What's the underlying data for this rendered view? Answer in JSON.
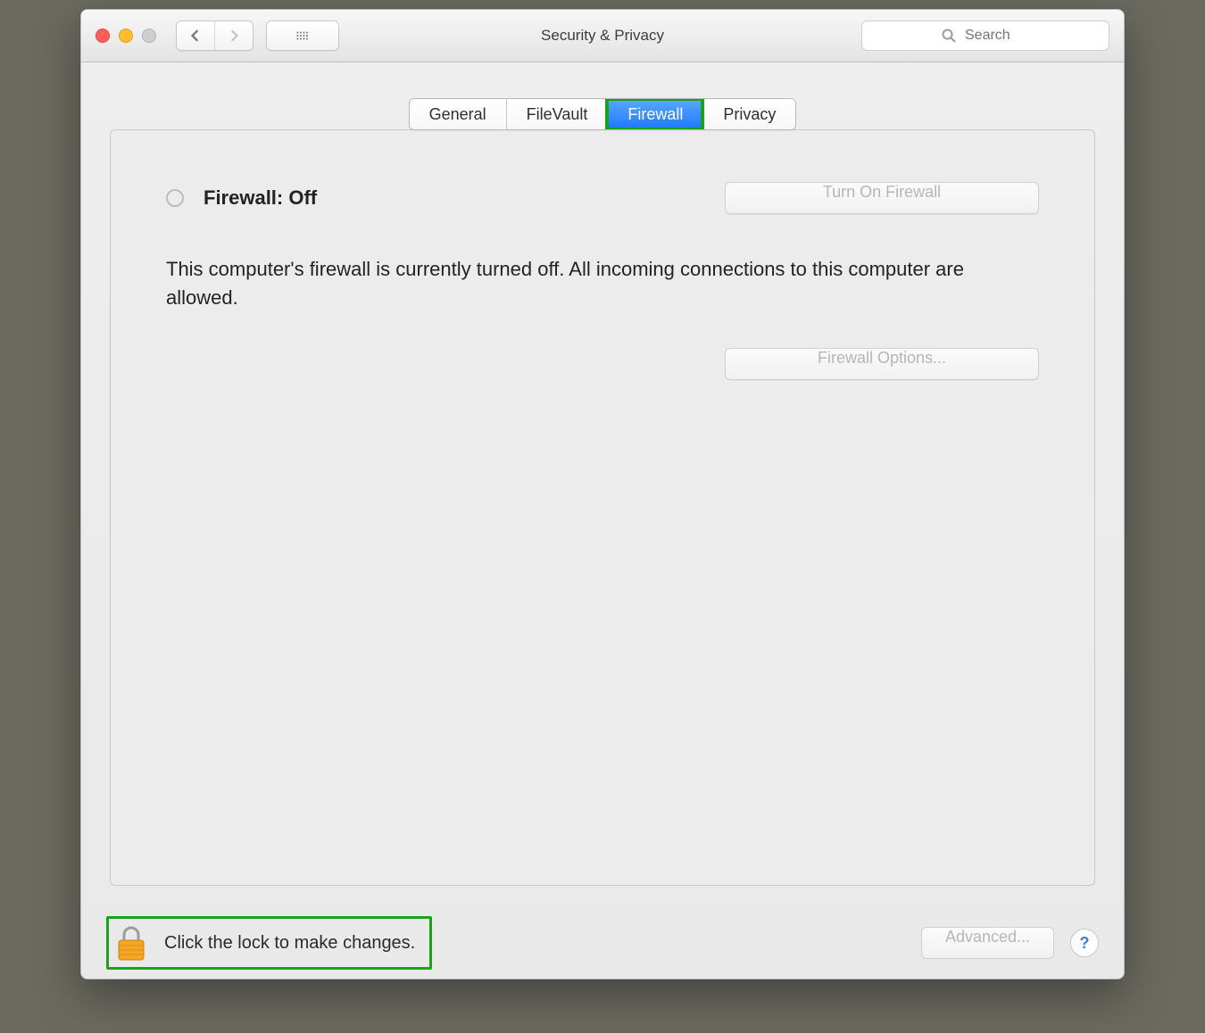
{
  "window": {
    "title": "Security & Privacy"
  },
  "search": {
    "placeholder": "Search"
  },
  "tabs": [
    {
      "label": "General",
      "active": false
    },
    {
      "label": "FileVault",
      "active": false
    },
    {
      "label": "Firewall",
      "active": true
    },
    {
      "label": "Privacy",
      "active": false
    }
  ],
  "firewall": {
    "status_label": "Firewall: Off",
    "turn_on_label": "Turn On Firewall",
    "description": "This computer's firewall is currently turned off. All incoming connections to this computer are allowed.",
    "options_label": "Firewall Options..."
  },
  "footer": {
    "lock_text": "Click the lock to make changes.",
    "advanced_label": "Advanced...",
    "help_label": "?"
  }
}
